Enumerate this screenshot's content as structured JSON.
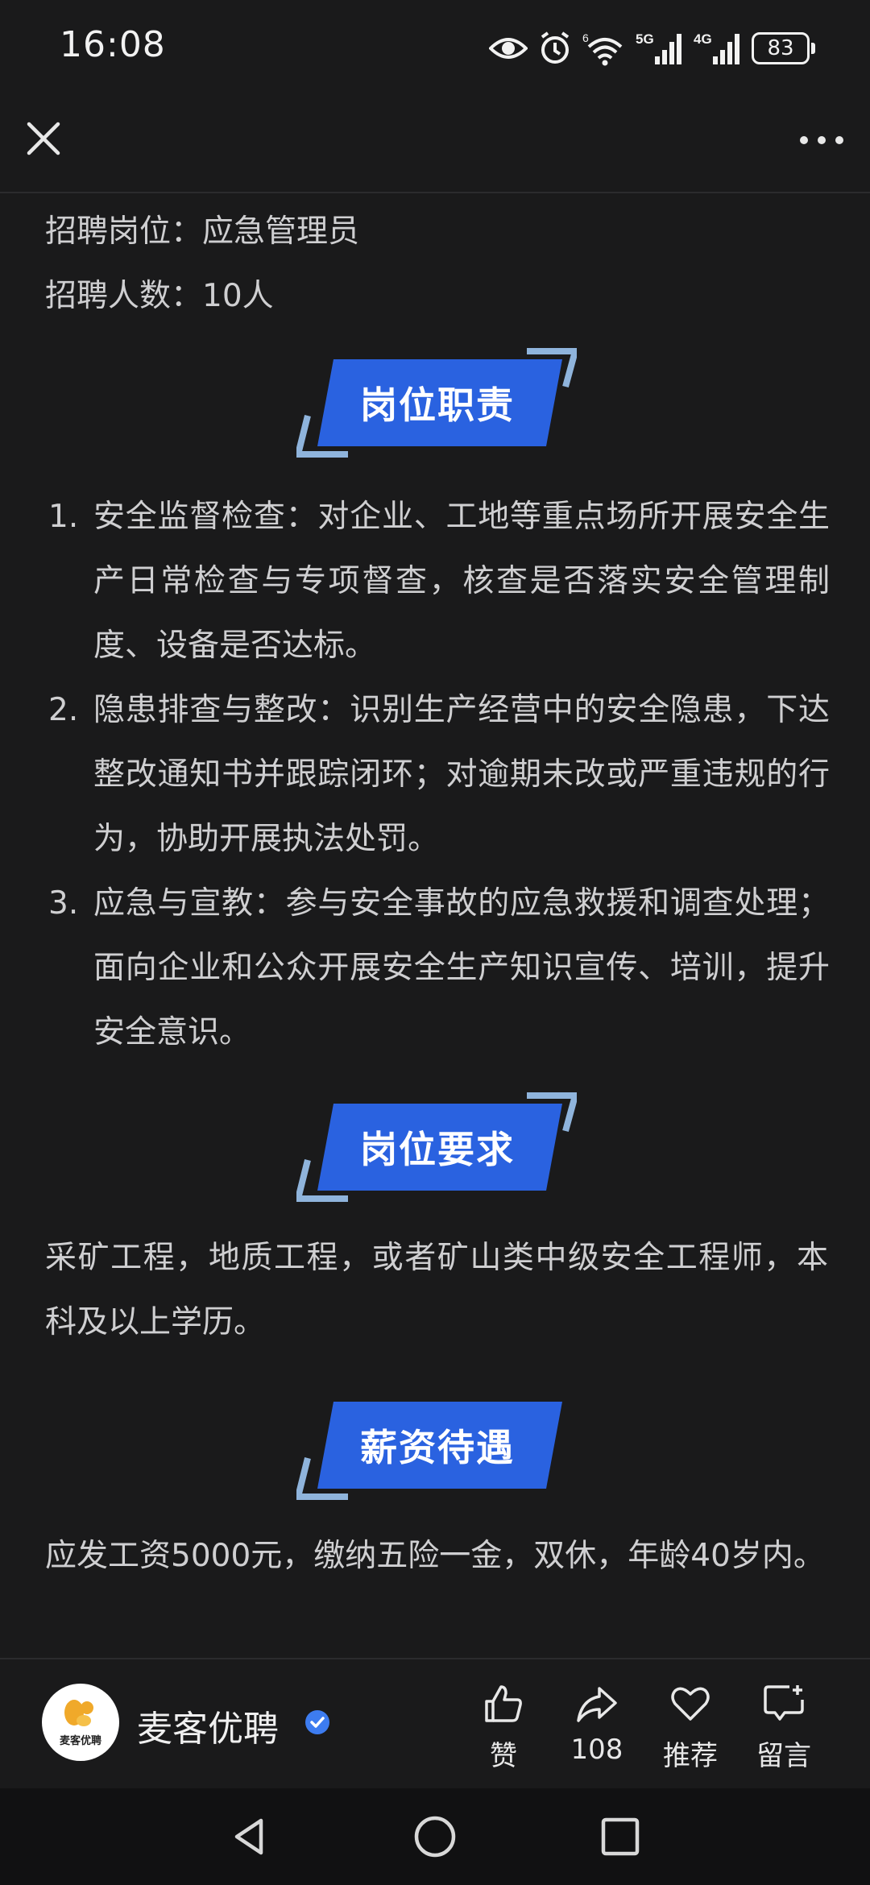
{
  "status_bar": {
    "time": "16:08",
    "icons": [
      "eye-icon",
      "alarm-icon",
      "wifi-icon",
      "signal-5g-icon",
      "signal-4g-icon"
    ],
    "wifi_sup": "6",
    "net1": "5G",
    "net2": "4G",
    "battery": "83"
  },
  "header": {
    "close_icon": "close-icon",
    "more_icon": "more-icon"
  },
  "content": {
    "position_line": "招聘岗位：应急管理员",
    "count_line": "招聘人数：10人",
    "sections": {
      "duties": "岗位职责",
      "requirements": "岗位要求",
      "salary": "薪资待遇"
    },
    "duties": [
      {
        "num": "1.",
        "text": "安全监督检查：对企业、工地等重点场所开展安全生产日常检查与专项督查，核查是否落实安全管理制度、设备是否达标。"
      },
      {
        "num": "2.",
        "text": "隐患排查与整改：识别生产经营中的安全隐患，下达整改通知书并跟踪闭环；对逾期未改或严重违规的行为，协助开展执法处罚。"
      },
      {
        "num": "3.",
        "text": "应急与宣教：参与安全事故的应急救援和调查处理；面向企业和公众开展安全生产知识宣传、培训，提升安全意识。"
      }
    ],
    "requirements_text": "采矿工程，地质工程，或者矿山类中级安全工程师，本科及以上学历。",
    "salary_text": "应发工资5000元，缴纳五险一金，双休，年龄40岁内。"
  },
  "footer": {
    "avatar_text": "麦客优聘",
    "author": "麦客优聘",
    "actions": {
      "like": "赞",
      "share": "108",
      "recommend": "推荐",
      "comment": "留言"
    }
  },
  "nav": {
    "back": "back-icon",
    "home": "home-icon",
    "recent": "recent-apps-icon"
  },
  "colors": {
    "background": "#1a1a1b",
    "accent_blue": "#2a62e0",
    "accent_light": "#8fb4dc",
    "text": "#cfcfd1"
  }
}
